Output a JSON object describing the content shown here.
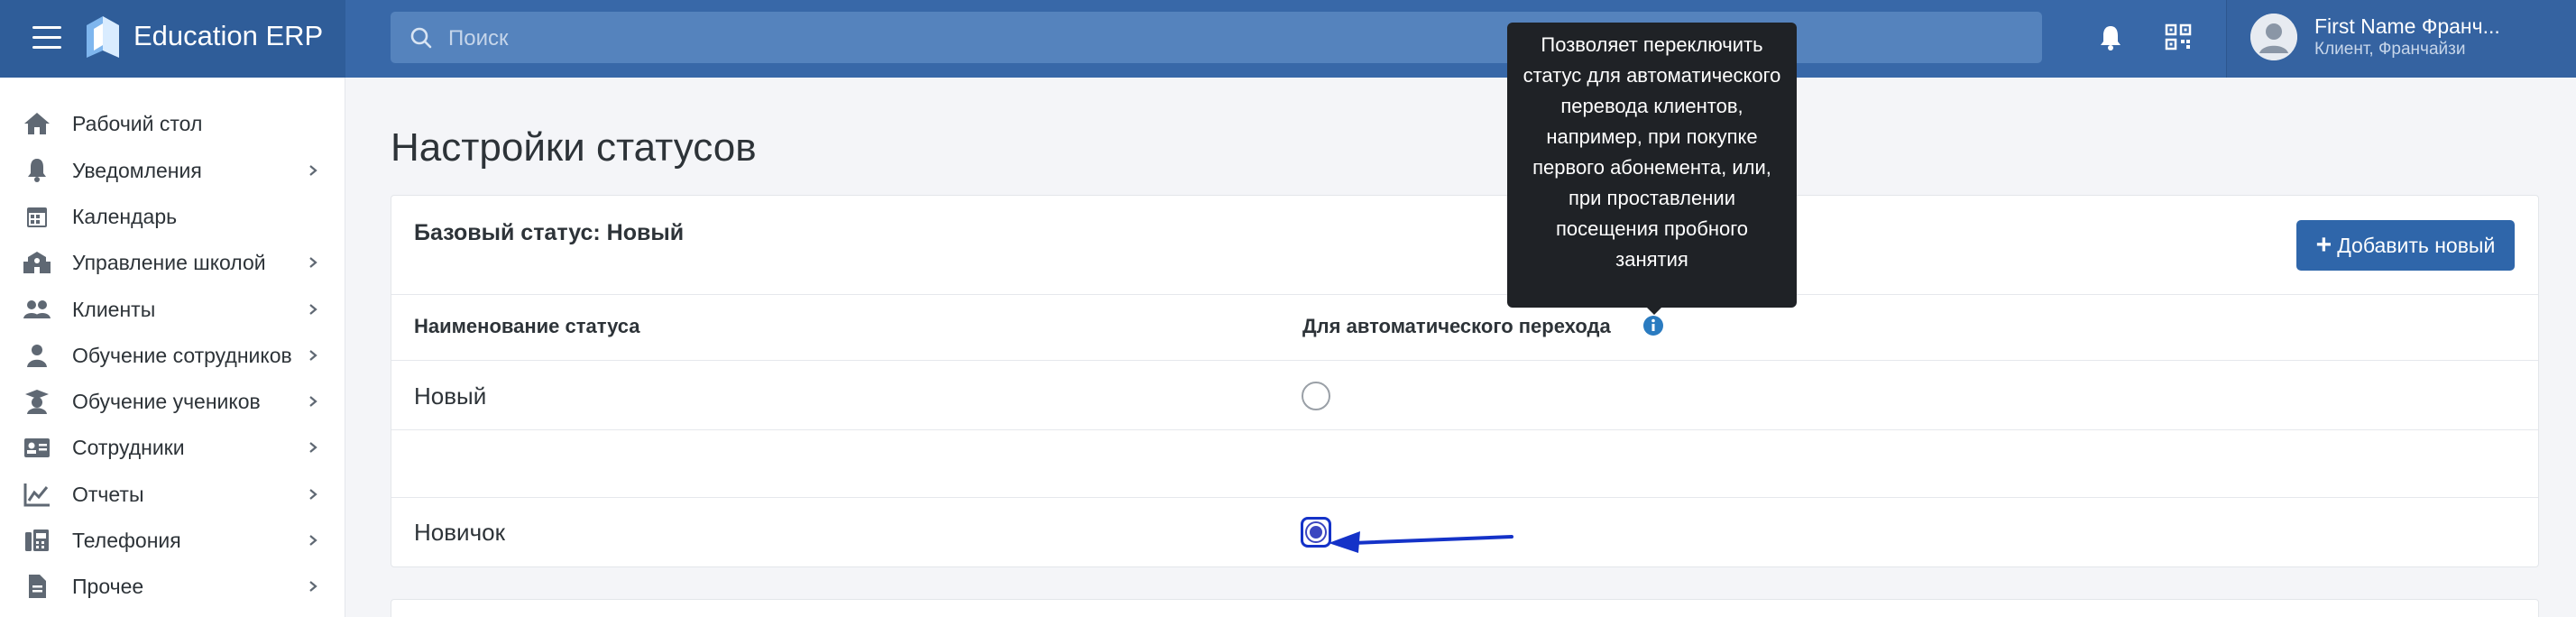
{
  "app": {
    "brand_name": "Education ERP"
  },
  "search": {
    "placeholder": "Поиск"
  },
  "user": {
    "name": "First Name Франч...",
    "role": "Клиент, Франчайзи"
  },
  "sidebar": {
    "items": [
      {
        "label": "Рабочий стол",
        "icon": "home-icon",
        "has_children": false
      },
      {
        "label": "Уведомления",
        "icon": "bell-icon",
        "has_children": true
      },
      {
        "label": "Календарь",
        "icon": "calendar-icon",
        "has_children": false
      },
      {
        "label": "Управление школой",
        "icon": "school-icon",
        "has_children": true
      },
      {
        "label": "Клиенты",
        "icon": "users-icon",
        "has_children": true
      },
      {
        "label": "Обучение сотрудников",
        "icon": "staff-training-icon",
        "has_children": true
      },
      {
        "label": "Обучение учеников",
        "icon": "graduation-cap-icon",
        "has_children": true
      },
      {
        "label": "Сотрудники",
        "icon": "id-card-icon",
        "has_children": true
      },
      {
        "label": "Отчеты",
        "icon": "chart-icon",
        "has_children": true
      },
      {
        "label": "Телефония",
        "icon": "fax-icon",
        "has_children": true
      },
      {
        "label": "Прочее",
        "icon": "file-icon",
        "has_children": true
      }
    ]
  },
  "page": {
    "title": "Настройки статусов",
    "card_title": "Базовый статус: Новый",
    "add_button": "Добавить новый",
    "columns": {
      "name": "Наименование статуса",
      "auto": "Для автоматического перехода"
    },
    "tooltip": "Позволяет переключить статус для автоматического перевода клиентов, например, при покупке первого абонемента, или, при проставлении посещения пробного занятия",
    "rows": [
      {
        "name": "Новый",
        "auto_selected": false
      },
      {
        "name": "",
        "auto_selected": null
      },
      {
        "name": "Новичок",
        "auto_selected": true
      }
    ]
  },
  "colors": {
    "topbar": "#3868a8",
    "brand_bg": "#2f5d99",
    "accent": "#2f66aa",
    "annotation_arrow": "#1432c8",
    "tooltip_bg": "#1f2226"
  }
}
